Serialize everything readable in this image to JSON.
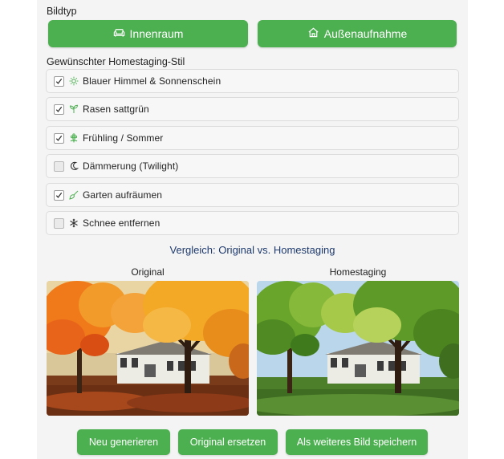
{
  "bildtyp": {
    "label": "Bildtyp",
    "buttons": [
      {
        "label": "Innenraum",
        "icon": "sofa-icon"
      },
      {
        "label": "Außenaufnahme",
        "icon": "house-icon"
      }
    ]
  },
  "stil": {
    "label": "Gewünschter Homestaging-Stil",
    "options": [
      {
        "label": "Blauer Himmel & Sonnenschein",
        "checked": true,
        "icon": "sun-icon"
      },
      {
        "label": "Rasen sattgrün",
        "checked": true,
        "icon": "sprout-icon"
      },
      {
        "label": "Frühling / Sommer",
        "checked": true,
        "icon": "flower-icon"
      },
      {
        "label": "Dämmerung (Twilight)",
        "checked": false,
        "icon": "moon-icon"
      },
      {
        "label": "Garten aufräumen",
        "checked": true,
        "icon": "broom-icon"
      },
      {
        "label": "Schnee entfernen",
        "checked": false,
        "icon": "snowflake-icon"
      }
    ]
  },
  "vergleich": {
    "title": "Vergleich: Original vs. Homestaging",
    "original_label": "Original",
    "staged_label": "Homestaging"
  },
  "actions": {
    "regenerate": "Neu generieren",
    "replace": "Original ersetzen",
    "save_as": "Als weiteres Bild speichern"
  },
  "colors": {
    "accent": "#4caf50",
    "title": "#1e3a6d"
  }
}
